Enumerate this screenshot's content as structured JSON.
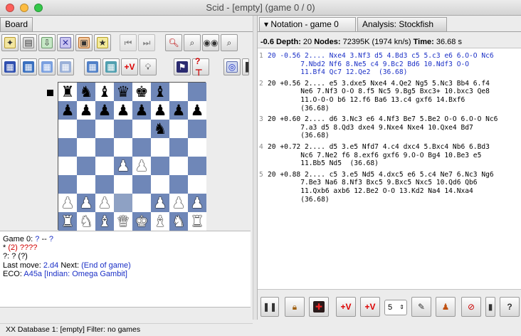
{
  "window": {
    "title": "Scid - [empty] (game 0 / 0)"
  },
  "left": {
    "tab_label": "Board",
    "board": {
      "side_to_move": "black",
      "rows": [
        [
          "r",
          "n",
          "b",
          "q",
          "k",
          "b",
          "",
          ""
        ],
        [
          "p",
          "p",
          "p",
          "p",
          "p",
          "p",
          "p",
          "p"
        ],
        [
          "",
          "",
          "",
          "",
          "",
          "n",
          "",
          ""
        ],
        [
          "",
          "",
          "",
          "",
          "",
          "",
          "",
          ""
        ],
        [
          "",
          "",
          "",
          "P",
          "P",
          "",
          "",
          ""
        ],
        [
          "",
          "",
          "",
          "",
          "",
          "",
          "",
          ""
        ],
        [
          "P",
          "P",
          "P",
          "",
          "",
          "P",
          "P",
          "P"
        ],
        [
          "R",
          "N",
          "B",
          "Q",
          "K",
          "B",
          "N",
          "R"
        ]
      ],
      "rook_h8_top": "r"
    },
    "info": {
      "game_line_prefix": "Game 0:",
      "white_player": "?",
      "sep": "--",
      "black_player": "?",
      "elo_star": "*",
      "elo_val": "(2)",
      "elo_q": "????",
      "q_line": "?: ? (?)",
      "last_move_label": "Last move:",
      "last_move": "2.d4",
      "next_label": "Next:",
      "next_value": "(End of game)",
      "eco_label": "ECO:",
      "eco_value": "A45a [Indian: Omega Gambit]"
    },
    "status": "XX  Database 1: [empty]   Filter: no games"
  },
  "right": {
    "tab_notation": "Notation - game 0",
    "tab_analysis": "Analysis: Stockfish",
    "header": {
      "score": "-0.6",
      "depth_label": "Depth:",
      "depth": "20",
      "nodes_label": "Nodes:",
      "nodes": "72395K (1974 kn/s)",
      "time_label": "Time:",
      "time": "36.68 s"
    },
    "lines": [
      {
        "n": "1",
        "text": "20 -0.56 2.... Nxe4 3.Nf3 d5 4.Bd3 c5 5.c3 e6 6.O-O Nc6\n        7.Nbd2 Nf6 8.Ne5 c4 9.Bc2 Bd6 10.Ndf3 O-O\n        11.Bf4 Qc7 12.Qe2  (36.68)"
      },
      {
        "n": "2",
        "text": "20 +0.56 2.... e5 3.dxe5 Nxe4 4.Qe2 Ng5 5.Nc3 Bb4 6.f4\n        Ne6 7.Nf3 O-O 8.f5 Nc5 9.Bg5 Bxc3+ 10.bxc3 Qe8\n        11.O-O-O b6 12.f6 Ba6 13.c4 gxf6 14.Bxf6\n        (36.68)"
      },
      {
        "n": "3",
        "text": "20 +0.60 2.... d6 3.Nc3 e6 4.Nf3 Be7 5.Be2 O-O 6.O-O Nc6\n        7.a3 d5 8.Qd3 dxe4 9.Nxe4 Nxe4 10.Qxe4 Bd7\n        (36.68)"
      },
      {
        "n": "4",
        "text": "20 +0.72 2.... d5 3.e5 Nfd7 4.c4 dxc4 5.Bxc4 Nb6 6.Bd3\n        Nc6 7.Ne2 f6 8.exf6 gxf6 9.O-O Bg4 10.Be3 e5\n        11.Bb5 Nd5  (36.68)"
      },
      {
        "n": "5",
        "text": "20 +0.88 2.... c5 3.e5 Nd5 4.dxc5 e6 5.c4 Ne7 6.Nc3 Ng6\n        7.Be3 Na6 8.Nf3 Bxc5 9.Bxc5 Nxc5 10.Qd6 Qb6\n        11.Qxb6 axb6 12.Be2 O-O 13.Kd2 Na4 14.Nxa4\n        (36.68)"
      }
    ],
    "multipv_value": "5"
  },
  "icons": {
    "pieces": {
      "k": "♚",
      "q": "♛",
      "r": "♜",
      "b": "♝",
      "n": "♞",
      "p": "♟",
      "K": "♚",
      "Q": "♛",
      "R": "♜",
      "B": "♝",
      "N": "♞",
      "P": "♟"
    }
  },
  "colors": {
    "dark_square": "#6f87b8",
    "light_square": "#ffffff",
    "blue_text": "#1a2fc6",
    "red_text": "#d10000"
  }
}
